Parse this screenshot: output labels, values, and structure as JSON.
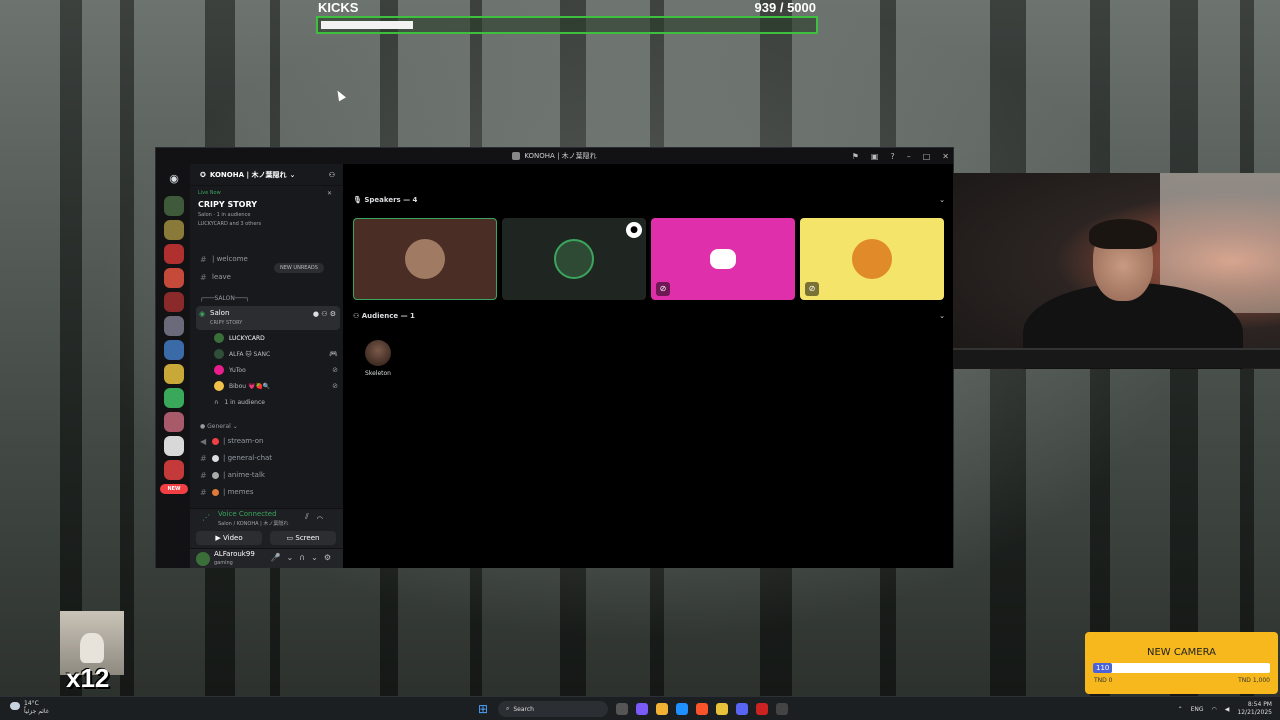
{
  "overlay": {
    "kicks_label": "KICKS",
    "kicks_count": "939 / 5000",
    "kicks_progress": 0.188,
    "multiplier": "x12"
  },
  "window": {
    "title": "KONOHA | 木ノ葉隠れ"
  },
  "server": {
    "name": "KONOHA | 木ノ葉隠れ",
    "live_tag": "Live Now",
    "live_title": "CRIPY STORY",
    "live_sub": "Salon · 1 in audience",
    "live_people": "LUCKYCARD and 3 others",
    "new_unreads": "NEW UNREADS",
    "new_pill": "NEW"
  },
  "channels_top": [
    {
      "label": "| welcome"
    },
    {
      "label": "leave"
    }
  ],
  "salon": {
    "category": "┌───SALON───┐",
    "voice_name": "Salon",
    "voice_sub": "CRIPY STORY",
    "users": [
      {
        "name": "LUCKYCARD",
        "color": "#3b6f3a"
      },
      {
        "name": "ALFA 🐱 SANC",
        "color": "#2f4f3a"
      },
      {
        "name": "YuToo",
        "color": "#e91e8c"
      },
      {
        "name": "Bibou 💗🍓🔍",
        "color": "#f0c24a"
      }
    ],
    "audience": "1 in audience"
  },
  "general": {
    "category": "General",
    "channels": [
      {
        "label": "| stream-on",
        "color": "#f23f43"
      },
      {
        "label": "| general-chat",
        "color": "#dbdee1"
      },
      {
        "label": "| anime-talk",
        "color": "#aaaaaa"
      },
      {
        "label": "| memes",
        "color": "#e07a3a"
      }
    ]
  },
  "voice_bar": {
    "status": "Voice Connected",
    "location": "Salon / KONOHA | 木ノ葉隠れ",
    "video": "Video",
    "screen": "Screen"
  },
  "user_panel": {
    "username": "ALFarouk99",
    "status": "gaming"
  },
  "stage": {
    "speakers_header": "Speakers — 4",
    "audience_header": "Audience — 1",
    "speakers": [
      {
        "bg": "#4a2e26",
        "avatar": "#a07a62",
        "selected": true
      },
      {
        "bg": "#1f2621",
        "avatar": "#2e4a34",
        "selected": false
      },
      {
        "bg": "#e02faa",
        "avatar": "discord",
        "selected": false
      },
      {
        "bg": "#f4e46a",
        "avatar": "#e08a2a",
        "selected": false
      }
    ],
    "audience_member": "Skeleton"
  },
  "goal_widget": {
    "title": "NEW CAMERA",
    "current": "110",
    "progress": 0.11,
    "min_label": "TND 0",
    "max_label": "TND 1,000"
  },
  "taskbar": {
    "temp": "14°C",
    "weather_sub": "غائم جزئياً",
    "search": "Search",
    "lang": "ENG",
    "time": "8:54 PM",
    "date": "12/21/2025"
  }
}
